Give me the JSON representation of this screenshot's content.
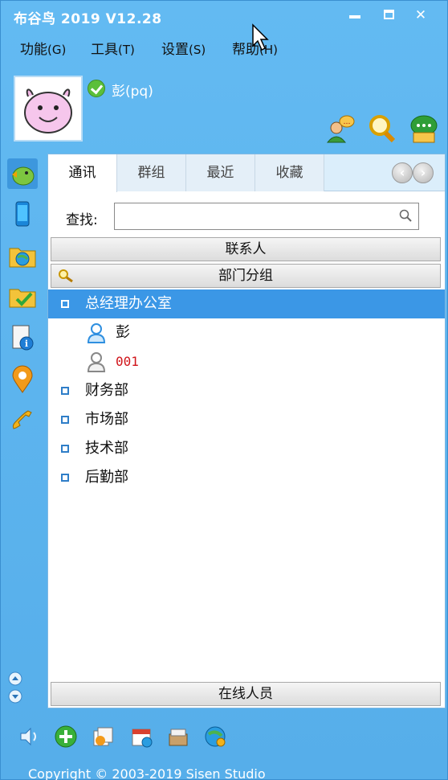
{
  "window": {
    "title": "布谷鸟 2019  V12.28",
    "controls": {
      "minimize": "minimize",
      "maximize": "maximize",
      "close": "close"
    }
  },
  "menu": {
    "items": [
      {
        "label": "功能",
        "hotkey": "(G)"
      },
      {
        "label": "工具",
        "hotkey": "(T)"
      },
      {
        "label": "设置",
        "hotkey": "(S)"
      },
      {
        "label": "帮助",
        "hotkey": "(H)"
      }
    ]
  },
  "profile": {
    "name": "彭(pq)",
    "status_icon": "online-check-icon",
    "avatar_icon": "pig-avatar-icon",
    "actions": [
      "add-contact-icon",
      "find-icon",
      "message-icon"
    ]
  },
  "sidebar": {
    "icons": [
      "bird-chat-icon",
      "phone-icon",
      "folder-globe-icon",
      "folder-check-icon",
      "info-doc-icon",
      "location-icon",
      "telephone-icon"
    ]
  },
  "tabs": [
    {
      "label": "通讯",
      "active": true
    },
    {
      "label": "群组",
      "active": false
    },
    {
      "label": "最近",
      "active": false
    },
    {
      "label": "收藏",
      "active": false
    }
  ],
  "search": {
    "label": "查找:",
    "value": "",
    "placeholder": ""
  },
  "sections": {
    "contacts": "联系人",
    "dept_groups": "部门分组",
    "online": "在线人员"
  },
  "tree": [
    {
      "type": "dept",
      "label": "总经理办公室",
      "selected": true
    },
    {
      "type": "person",
      "label": "彭",
      "online": true
    },
    {
      "type": "person",
      "label": "001",
      "online": false
    },
    {
      "type": "dept",
      "label": "财务部",
      "selected": false
    },
    {
      "type": "dept",
      "label": "市场部",
      "selected": false
    },
    {
      "type": "dept",
      "label": "技术部",
      "selected": false
    },
    {
      "type": "dept",
      "label": "后勤部",
      "selected": false
    }
  ],
  "bottom_toolbar": [
    "volume-icon",
    "add-icon",
    "files-icon",
    "calendar-icon",
    "archive-icon",
    "network-icon"
  ],
  "copyright": "Copyright © 2003-2019 Sisen Studio",
  "colors": {
    "accent": "#5fb6f0",
    "selected": "#3b97e6",
    "offline_user": "#d0141a"
  }
}
